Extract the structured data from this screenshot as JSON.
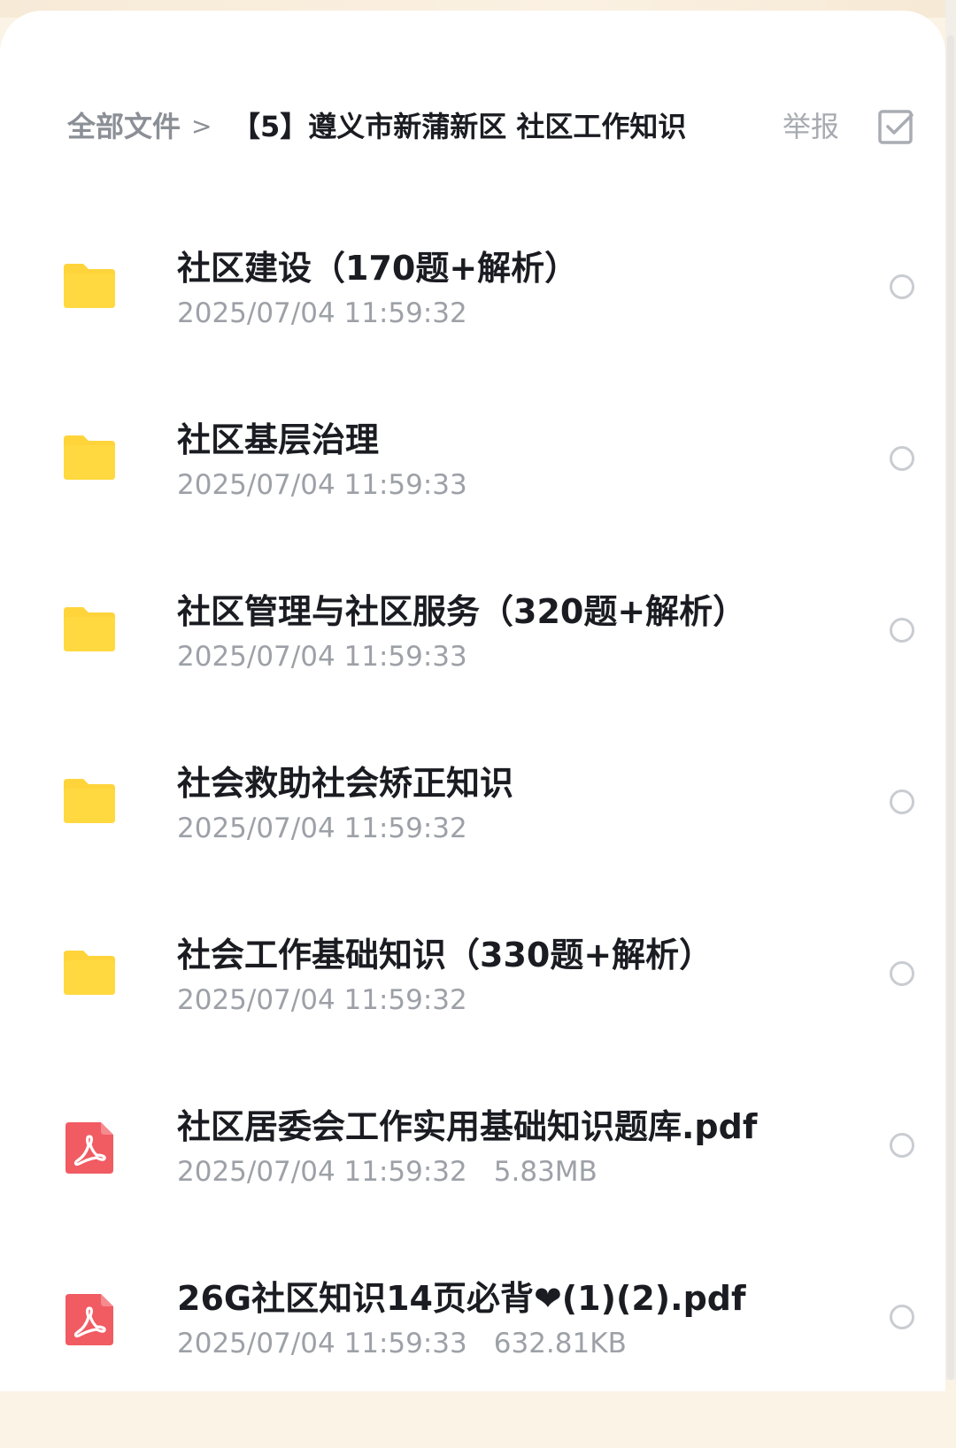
{
  "breadcrumb": {
    "root": "全部文件",
    "separator": ">",
    "current": "【5】遵义市新蒲新区 社区工作知识"
  },
  "header": {
    "report_label": "举报",
    "select_icon": "checkbox-select-icon"
  },
  "colors": {
    "folder": "#ffd43b",
    "pdf": "#f15b62",
    "text_primary": "#1b1c22",
    "text_secondary": "#9da1a7"
  },
  "files": [
    {
      "type": "folder",
      "icon": "folder-icon",
      "name": "社区建设（170题+解析）",
      "date": "2025/07/04 11:59:32",
      "size": ""
    },
    {
      "type": "folder",
      "icon": "folder-icon",
      "name": "社区基层治理",
      "date": "2025/07/04 11:59:33",
      "size": ""
    },
    {
      "type": "folder",
      "icon": "folder-icon",
      "name": "社区管理与社区服务（320题+解析）",
      "date": "2025/07/04 11:59:33",
      "size": ""
    },
    {
      "type": "folder",
      "icon": "folder-icon",
      "name": "社会救助社会矫正知识",
      "date": "2025/07/04 11:59:32",
      "size": ""
    },
    {
      "type": "folder",
      "icon": "folder-icon",
      "name": "社会工作基础知识（330题+解析）",
      "date": "2025/07/04 11:59:32",
      "size": ""
    },
    {
      "type": "pdf",
      "icon": "pdf-icon",
      "name": "社区居委会工作实用基础知识题库.pdf",
      "date": "2025/07/04 11:59:32",
      "size": "5.83MB"
    },
    {
      "type": "pdf",
      "icon": "pdf-icon",
      "name": "26G社区知识14页必背❤(1)(2).pdf",
      "date": "2025/07/04 11:59:33",
      "size": "632.81KB"
    }
  ]
}
